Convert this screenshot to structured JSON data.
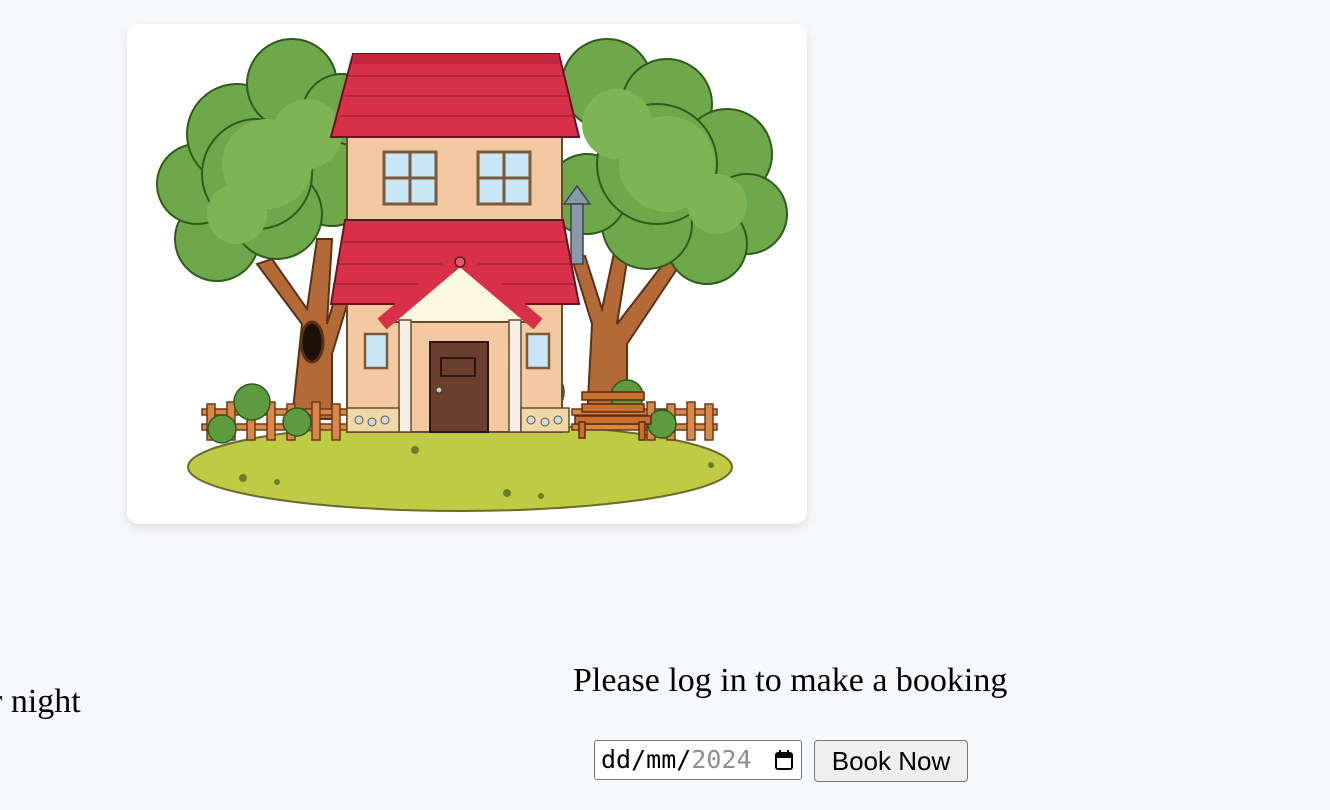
{
  "listing": {
    "image_alt": "House illustration",
    "price_text": "r night"
  },
  "booking": {
    "login_message": "Please log in to make a booking",
    "date_input": {
      "day_placeholder": "dd",
      "month_placeholder": "mm",
      "year_placeholder": "2024",
      "separator": "/"
    },
    "book_button_label": "Book Now"
  },
  "colors": {
    "page_background": "#f7f8fa",
    "roof": "#d9304a",
    "wall": "#f2c9a0",
    "tree_leaves": "#6fa84a",
    "grass": "#bfcb45"
  }
}
